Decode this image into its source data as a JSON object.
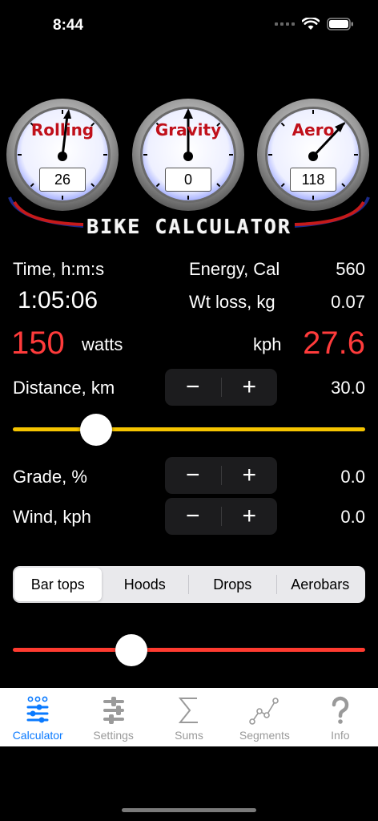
{
  "status": {
    "time": "8:44"
  },
  "gauges": [
    {
      "label": "Rolling",
      "value": "26"
    },
    {
      "label": "Gravity",
      "value": "0"
    },
    {
      "label": "Aero",
      "value": "118"
    }
  ],
  "app_title": "BIKE CALCULATOR",
  "results": {
    "time_label": "Time, h:m:s",
    "time_value": "1:05:06",
    "energy_label": "Energy, Cal",
    "energy_value": "560",
    "wtloss_label": "Wt loss, kg",
    "wtloss_value": "0.07",
    "power_value": "150",
    "power_unit": "watts",
    "speed_unit": "kph",
    "speed_value": "27.6"
  },
  "inputs": {
    "distance_label": "Distance, km",
    "distance_value": "30.0",
    "distance_slider_fraction": 0.21,
    "grade_label": "Grade, %",
    "grade_value": "0.0",
    "wind_label": "Wind, kph",
    "wind_value": "0.0",
    "minus": "−",
    "plus": "+",
    "position_slider_fraction": 0.32
  },
  "positions": {
    "options": [
      "Bar tops",
      "Hoods",
      "Drops",
      "Aerobars"
    ],
    "selected": "Bar tops"
  },
  "tabs": [
    {
      "label": "Calculator",
      "icon": "calculator-icon",
      "active": true
    },
    {
      "label": "Settings",
      "icon": "sliders-icon",
      "active": false
    },
    {
      "label": "Sums",
      "icon": "sigma-icon",
      "active": false
    },
    {
      "label": "Segments",
      "icon": "line-graph-icon",
      "active": false
    },
    {
      "label": "Info",
      "icon": "question-icon",
      "active": false
    }
  ],
  "colors": {
    "accent_red": "#ff3b3b",
    "distance_slider": "#f5c400",
    "position_slider": "#ff3b30",
    "tab_active": "#0a7aff",
    "tab_inactive": "#9a9a9a"
  }
}
